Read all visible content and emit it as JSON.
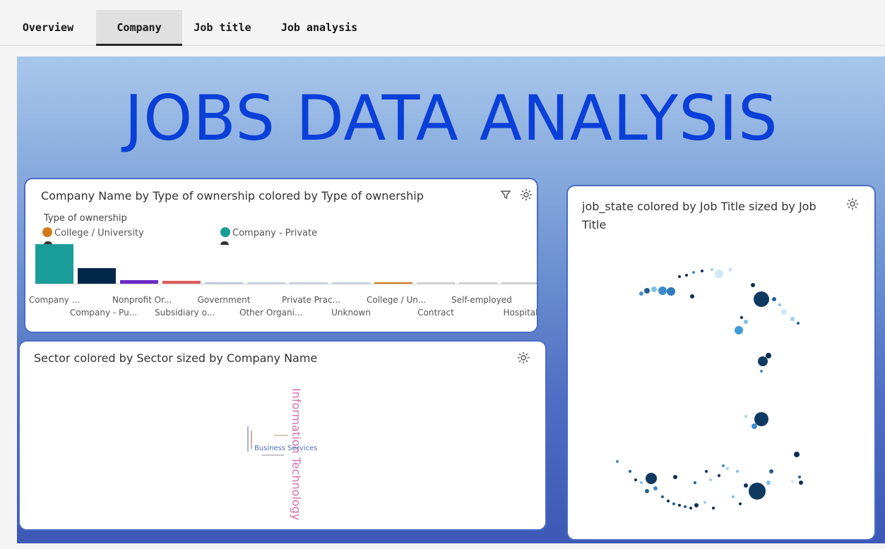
{
  "tabs": [
    {
      "label": "Overview"
    },
    {
      "label": "Company"
    },
    {
      "label": "Job title"
    },
    {
      "label": "Job analysis"
    }
  ],
  "dashboard": {
    "title": "JOBS DATA ANALYSIS"
  },
  "ownership_card": {
    "title": "Company Name by Type of ownership colored by Type of ownership",
    "filter_icon": "filter-icon",
    "settings_icon": "settings-icon",
    "legend_title": "Type of ownership",
    "legend": [
      {
        "label": "College / University",
        "color": "#d2791c"
      },
      {
        "label": "Company - Private",
        "color": "#1a9c99"
      }
    ]
  },
  "sector_card": {
    "title": "Sector colored by Sector sized by Company Name",
    "settings_icon": "settings-icon",
    "words": {
      "main": "Information Technology",
      "second": "Business Services"
    }
  },
  "state_card": {
    "title": "job_state colored by Job Title sized by Job Title",
    "settings_icon": "settings-icon"
  },
  "chart_data": {
    "type": "bar",
    "title": "Company Name by Type of ownership colored by Type of ownership",
    "categories": [
      "Company ...",
      "Company - Pu...",
      "Nonprofit Or...",
      "Subsidiary o...",
      "Government",
      "Other Organi...",
      "Private Prac...",
      "Unknown",
      "College / Un...",
      "Contract",
      "Self-employed",
      "Hospital"
    ],
    "values": [
      100,
      40,
      9,
      7,
      3,
      2,
      2,
      2,
      1,
      1,
      1,
      1
    ],
    "colors": [
      "#1a9c99",
      "#012749",
      "#6929c4",
      "#e05a5a",
      "#b9c4e8",
      "#c8d0e4",
      "#c8d0e4",
      "#c8d0e4",
      "#d2791c",
      "#d0d0d0",
      "#d0d0d0",
      "#d0d0d0"
    ],
    "legend_position": "top-left",
    "grid": false
  }
}
